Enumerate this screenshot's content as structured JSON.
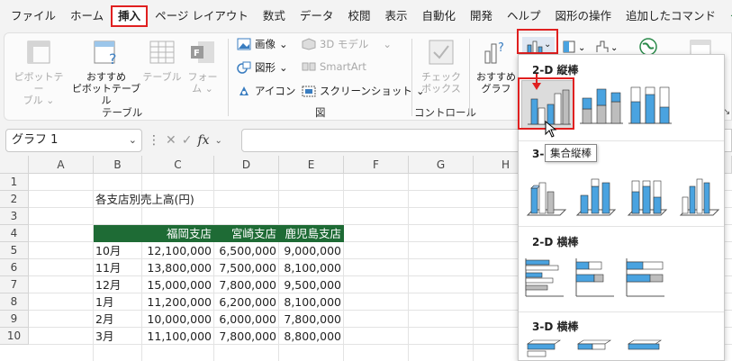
{
  "menu": {
    "tabs": [
      "ファイル",
      "ホーム",
      "挿入",
      "ページ レイアウト",
      "数式",
      "データ",
      "校閲",
      "表示",
      "自動化",
      "開発",
      "ヘルプ",
      "図形の操作",
      "追加したコマンド",
      "グ"
    ],
    "active": "挿入"
  },
  "ribbon": {
    "pivot_table": "ピボットテー\nブル ⌄",
    "recommended_pivot": "おすすめ\nピボットテーブル",
    "table": "テーブル",
    "form": "フォー\nム ⌄",
    "group_table": "テーブル",
    "image": "画像",
    "shape": "図形",
    "icon": "アイコン",
    "model3d": "3D モデル",
    "smartart": "SmartArt",
    "screenshot": "スクリーンショット",
    "group_figure": "図",
    "checkbox": "チェック\nボックス",
    "group_control": "コントロール",
    "recommended_chart": "おすすめ\nグラフ"
  },
  "formula_bar": {
    "name_box": "グラフ 1",
    "fx": "fx"
  },
  "sheet": {
    "columns": [
      "A",
      "B",
      "C",
      "D",
      "E",
      "F",
      "G",
      "H"
    ],
    "rows": [
      "1",
      "2",
      "3",
      "4",
      "5",
      "6",
      "7",
      "8",
      "9",
      "10"
    ],
    "title": "各支店別売上高(円)",
    "headers": [
      "福岡支店",
      "宮崎支店",
      "鹿児島支店"
    ],
    "data": [
      {
        "month": "10月",
        "values": [
          "12,100,000",
          "6,500,000",
          "9,000,000"
        ]
      },
      {
        "month": "11月",
        "values": [
          "13,800,000",
          "7,500,000",
          "8,100,000"
        ]
      },
      {
        "month": "12月",
        "values": [
          "15,000,000",
          "7,800,000",
          "9,500,000"
        ]
      },
      {
        "month": "1月",
        "values": [
          "11,200,000",
          "6,200,000",
          "8,100,000"
        ]
      },
      {
        "month": "2月",
        "values": [
          "10,000,000",
          "6,000,000",
          "7,800,000"
        ]
      },
      {
        "month": "3月",
        "values": [
          "11,100,000",
          "7,800,000",
          "8,800,000"
        ]
      }
    ],
    "header_color": "#1e6b35"
  },
  "chart_menu": {
    "section_2d_column": "2-D 縦棒",
    "section_3d_column_prefix": "3-",
    "section_2d_bar": "2-D 横棒",
    "section_3d_bar": "3-D 横棒",
    "tooltip": "集合縦棒"
  },
  "colors": {
    "accent_red": "#e02020",
    "bar_blue": "#4aa3e0",
    "bar_gray": "#bdbdbd"
  }
}
